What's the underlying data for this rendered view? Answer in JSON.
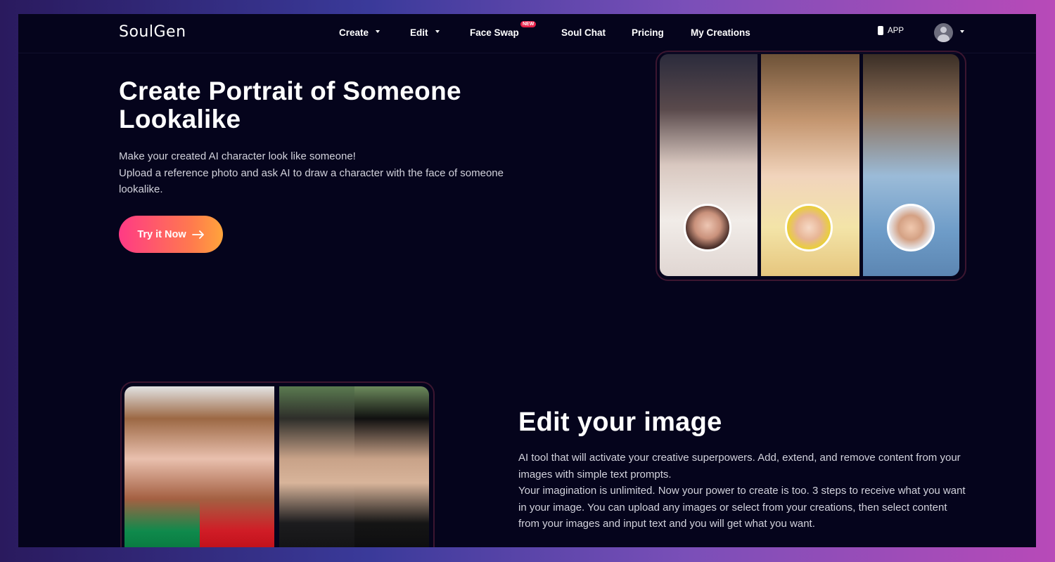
{
  "nav": {
    "logo": "SoulGen",
    "items": [
      {
        "label": "Create",
        "dropdown": true
      },
      {
        "label": "Edit",
        "dropdown": true
      },
      {
        "label": "Face Swap",
        "badge": "NEW"
      },
      {
        "label": "Soul Chat"
      },
      {
        "label": "Pricing"
      },
      {
        "label": "My Creations"
      }
    ],
    "app_label": "APP",
    "avatar_icon": "user-avatar-icon"
  },
  "hero": {
    "title": "Create Portrait of Someone Lookalike",
    "description_line1": "Make your created AI character look like someone!",
    "description_line2": "Upload a reference photo and ask AI to draw a character with the face of someone lookalike.",
    "cta_label": "Try it Now",
    "cta_icon": "arrow-right-icon"
  },
  "edit_section": {
    "title": "Edit your image",
    "paragraph1": "AI tool that will activate your creative superpowers. Add, extend, and remove content from your images with simple text prompts.",
    "paragraph2": "Your imagination is unlimited. Now your power to create is too. 3 steps to receive what you want in your image. You can upload any images or select from your creations, then select content from your images and input text and you will get what you want."
  },
  "colors": {
    "background": "#05041c",
    "cta_gradient_start": "#ff3a85",
    "cta_gradient_end": "#ffa43b",
    "badge": "#e8224a",
    "frame_outline": "#3c1630"
  }
}
